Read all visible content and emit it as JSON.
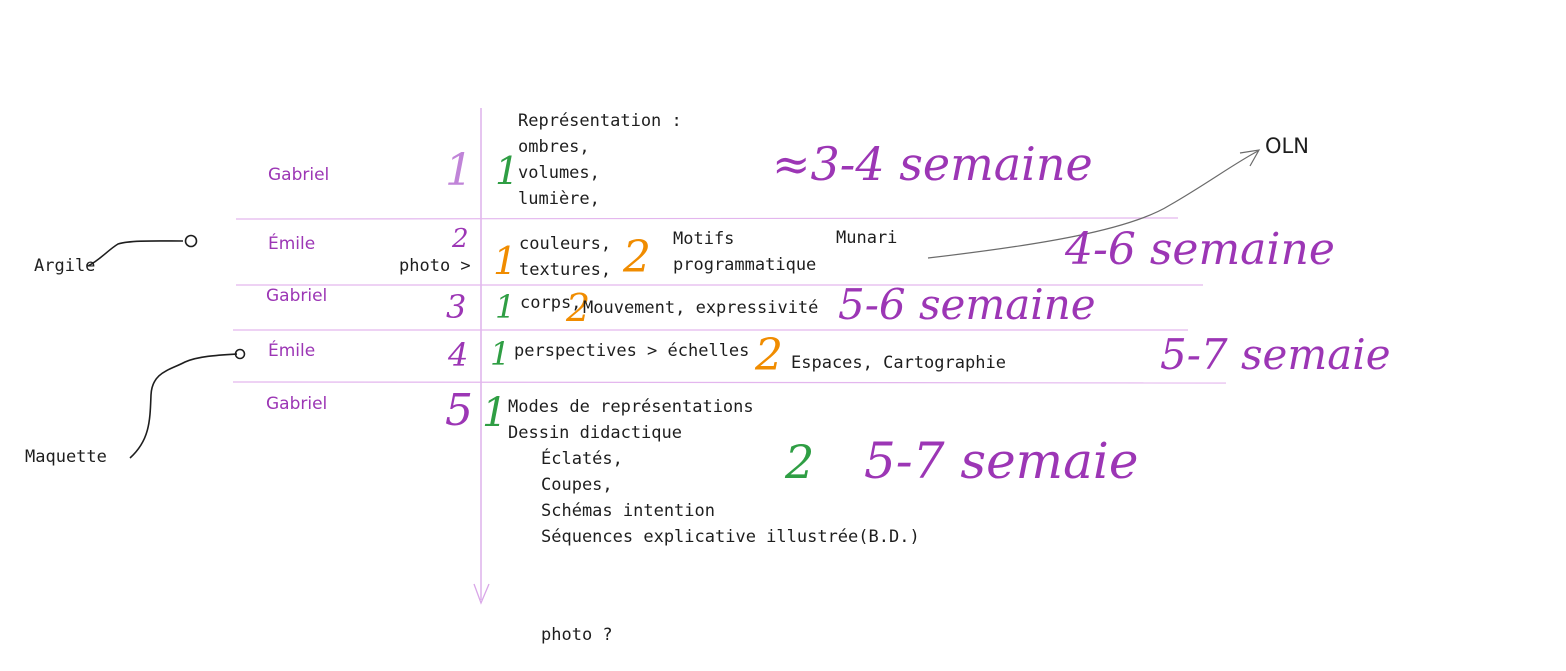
{
  "colors": {
    "purple": "#9c36b5",
    "light_purple": "#c084d8",
    "green": "#2f9e44",
    "orange": "#f08c00",
    "ink": "#1e1e1e",
    "line": "#e3b6ee"
  },
  "external": {
    "argile": "Argile",
    "maquette": "Maquette",
    "oln": "OLN"
  },
  "rows": [
    {
      "name": "Gabriel",
      "number": "1",
      "level1": "1",
      "topics": "Représentation :\nombres,\nvolumes,\nlumière,",
      "estimate": "≈3-4 semaine"
    },
    {
      "name": "Émile",
      "number": "2",
      "prefix": "photo >",
      "level1": "1",
      "topics": "couleurs,\ntextures,",
      "level2": "2",
      "topics2": "Motifs\nprogrammatique",
      "reference": "Munari",
      "estimate": "4-6 semaine"
    },
    {
      "name": "Gabriel",
      "number": "3",
      "level1": "1",
      "topics": "corps,",
      "level2": "2",
      "topics2": "Mouvement, expressivité",
      "estimate": "5-6 semaine"
    },
    {
      "name": "Émile",
      "number": "4",
      "level1": "1",
      "topics": "perspectives > échelles",
      "level2": "2",
      "topics2": "Espaces, Cartographie",
      "estimate": "5-7 semaie"
    },
    {
      "name": "Gabriel",
      "number": "5",
      "level1": "1",
      "topics": "Modes de représentations\nDessin didactique",
      "subtopics": "Éclatés,\nCoupes,\nSchémas intention\nSéquences explicative illustrée(B.D.)",
      "level2": "2",
      "estimate": "5-7 semaie"
    }
  ],
  "footer_note": "photo ?"
}
